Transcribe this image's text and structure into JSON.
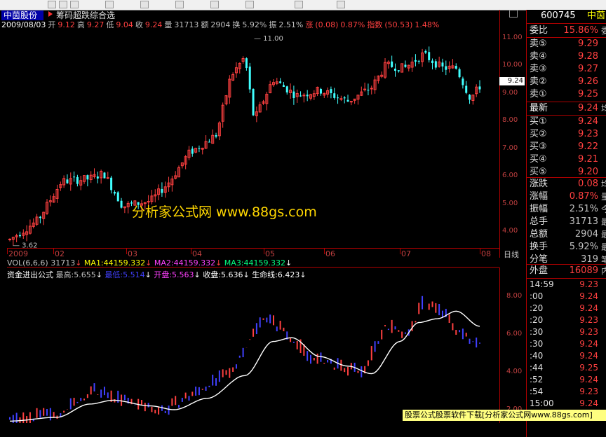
{
  "toolbar": {
    "icons": [
      "arrow-icon",
      "text-icon",
      "line-icon",
      "pen-icon",
      "rect-icon",
      "fib-icon",
      "chart-icon",
      "table-icon",
      "color-icon",
      "save-icon"
    ]
  },
  "stock": {
    "name": "中茵股份",
    "code": "600745",
    "short": "中茵"
  },
  "formula": {
    "name": "筹码超跌综合选"
  },
  "info": {
    "date": "2009/08/03",
    "open_label": "开",
    "open": "9.12",
    "high_label": "高",
    "high": "9.27",
    "low_label": "低",
    "low": "9.04",
    "close_label": "收",
    "close": "9.24",
    "vol_label": "量",
    "vol": "31713",
    "amt_label": "额",
    "amt": "2904",
    "turnover_label": "换",
    "turnover": "5.92%",
    "amplitude_label": "振",
    "amplitude": "2.51%",
    "change_label": "涨",
    "change": "(0.08)",
    "change_pct": "0.87%",
    "index_label": "指数",
    "index": "(50.53)",
    "index_pct": "1.48%"
  },
  "price_axis": [
    "11.00",
    "10.00",
    "9.00",
    "8.00",
    "7.00",
    "6.00",
    "5.00",
    "4.00"
  ],
  "price_marker": "9.24",
  "hi_annotation": "11.00",
  "lo_annotation": "3.62",
  "x_labels": [
    "2009",
    "02",
    "03",
    "04",
    "05",
    "06",
    "07",
    "08"
  ],
  "period_label": "日线",
  "vol_line": {
    "name": "VOL(6,6,6)",
    "vol": "31713",
    "ma1": "MA1:44159.332",
    "ma2": "MA2:44159.332",
    "ma3": "MA3:44159.332"
  },
  "indicator": {
    "name": "资金进出公式",
    "high": "最高:5.655",
    "low": "最低:5.514",
    "open": "开盘:5.563",
    "close": "收盘:5.636",
    "life": "生命线:6.423"
  },
  "ind_axis": [
    "8.00",
    "6.00",
    "4.00",
    "2.00"
  ],
  "quote": {
    "weibi_label": "委比",
    "weibi": "15.86%",
    "weibi_edge": "委",
    "asks": [
      {
        "label": "卖⑤",
        "price": "9.29"
      },
      {
        "label": "卖④",
        "price": "9.28"
      },
      {
        "label": "卖③",
        "price": "9.27"
      },
      {
        "label": "卖②",
        "price": "9.26"
      },
      {
        "label": "卖①",
        "price": "9.25"
      }
    ],
    "latest_label": "最新",
    "latest": "9.24",
    "latest_edge": "均",
    "bids": [
      {
        "label": "买①",
        "price": "9.24"
      },
      {
        "label": "买②",
        "price": "9.23"
      },
      {
        "label": "买③",
        "price": "9.22"
      },
      {
        "label": "买④",
        "price": "9.21"
      },
      {
        "label": "买⑤",
        "price": "9.20"
      }
    ],
    "stats": [
      {
        "label": "涨跌",
        "value": "0.08",
        "edge": "均",
        "cls": "red"
      },
      {
        "label": "涨幅",
        "value": "0.87%",
        "edge": "量",
        "cls": "red"
      },
      {
        "label": "振幅",
        "value": "2.51%",
        "edge": "今",
        "cls": "lg"
      },
      {
        "label": "总手",
        "value": "31713",
        "edge": "最",
        "cls": "lg"
      },
      {
        "label": "总额",
        "value": "2904",
        "edge": "最",
        "cls": "lg"
      },
      {
        "label": "换手",
        "value": "5.92%",
        "edge": "最",
        "cls": "lg"
      },
      {
        "label": "分笔",
        "value": "319",
        "edge": "笔",
        "cls": "lg"
      }
    ],
    "outer_label": "外盘",
    "outer": "16089",
    "outer_edge": "内"
  },
  "ticks": [
    {
      "t": "14:59",
      "p": "9.23"
    },
    {
      "t": ":00",
      "p": "9.24"
    },
    {
      "t": ":20",
      "p": "9.24"
    },
    {
      "t": ":20",
      "p": "9.23"
    },
    {
      "t": ":30",
      "p": "9.23"
    },
    {
      "t": ":30",
      "p": "9.24"
    },
    {
      "t": ":40",
      "p": "9.24"
    },
    {
      "t": ":44",
      "p": "9.25"
    },
    {
      "t": ":52",
      "p": "9.24"
    },
    {
      "t": ":54",
      "p": "9.23"
    },
    {
      "t": "15:00",
      "p": "9.24"
    }
  ],
  "watermark": {
    "main": "分析家公式网 www.88gs.com"
  },
  "footer": {
    "text": "股票公式股票软件下载[分析家公式网www.88gs.com]"
  },
  "colors": {
    "up": "#ff4040",
    "down": "#40ffff",
    "axis": "#b00000",
    "bg": "#000000"
  }
}
